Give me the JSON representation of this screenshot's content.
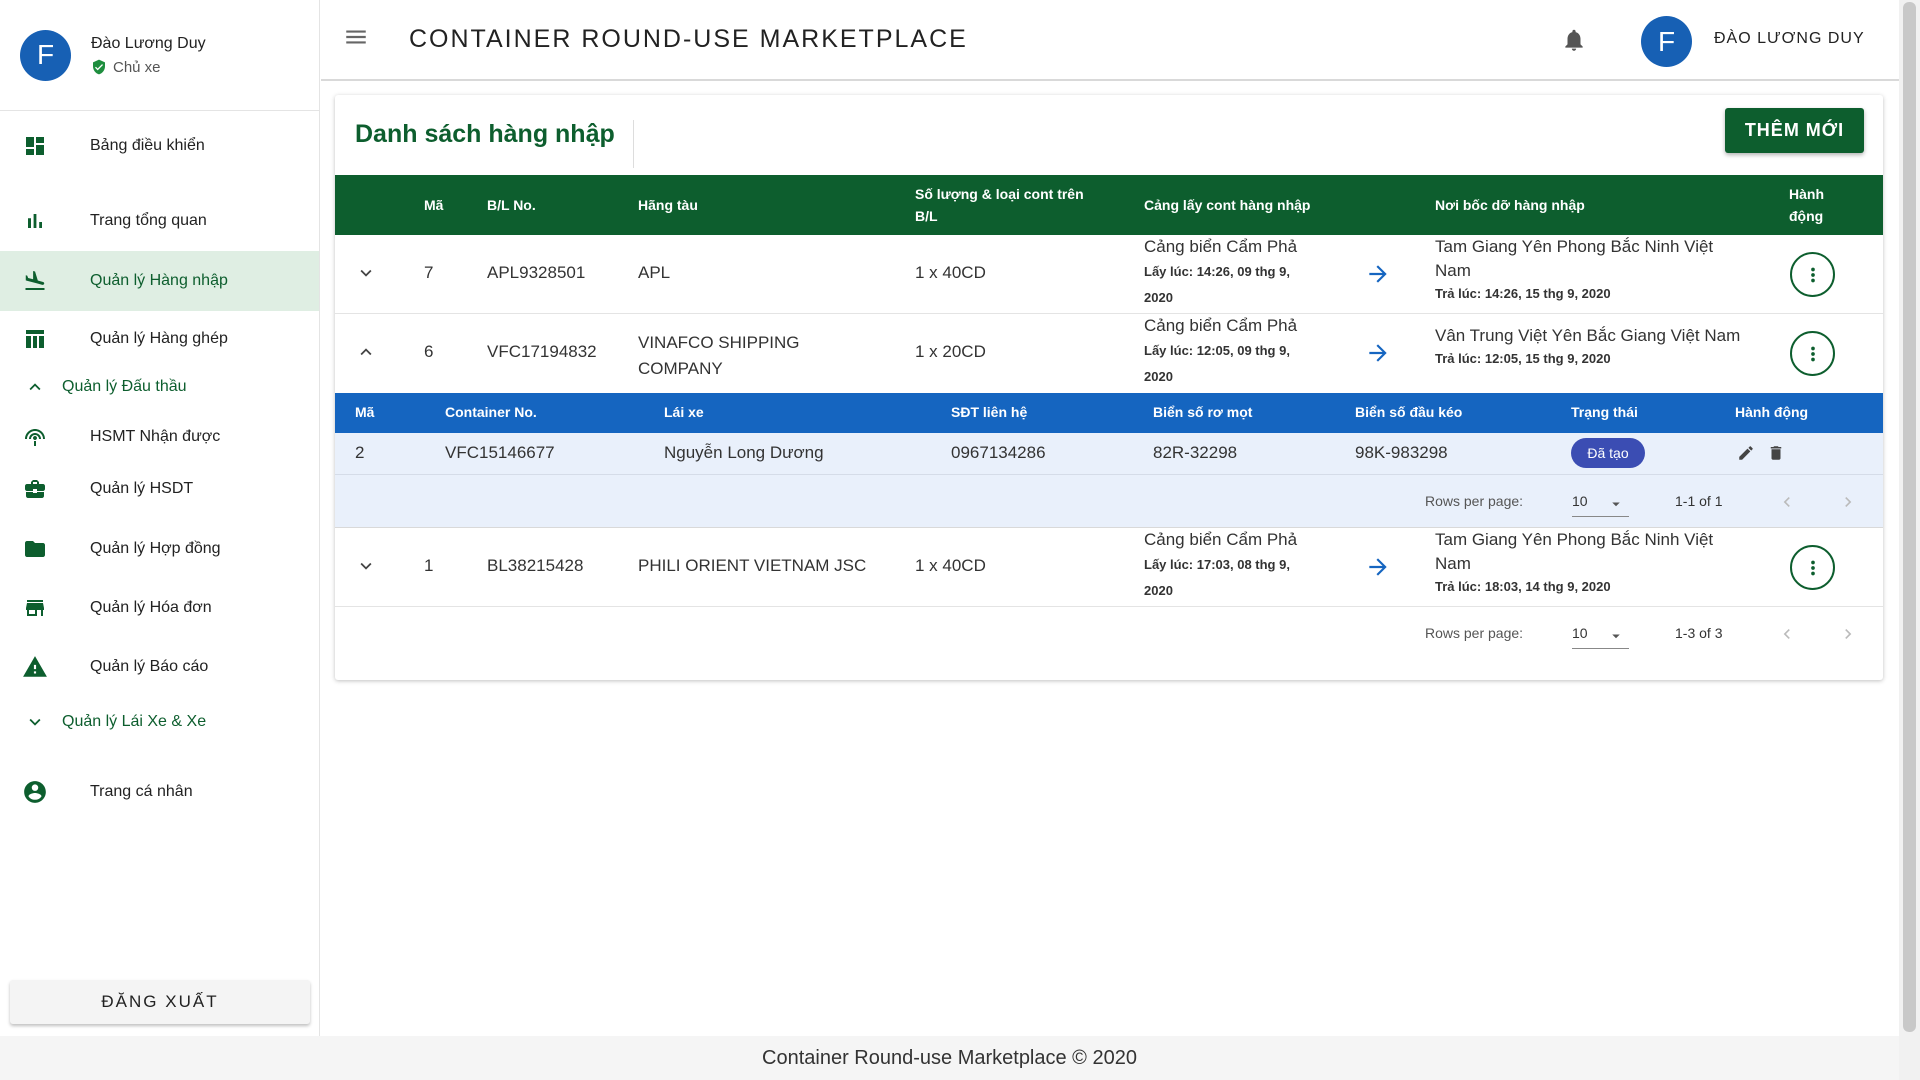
{
  "sidebar": {
    "user": {
      "avatar_letter": "F",
      "name": "Đào Lương Duy",
      "role": "Chủ xe"
    },
    "items": [
      {
        "label": "Bảng điều khiển",
        "icon": "dashboard-icon"
      },
      {
        "label": "Trang tổng quan",
        "icon": "bar-chart-icon"
      },
      {
        "label": "Quản lý Hàng nhập",
        "icon": "flight-land-icon"
      },
      {
        "label": "Quản lý Hàng ghép",
        "icon": "table-icon"
      },
      {
        "label": "Quản lý Đấu thầu",
        "icon": "chevron-up-icon"
      },
      {
        "label": "HSMT Nhận được",
        "icon": "wifi-tethering-icon"
      },
      {
        "label": "Quản lý HSDT",
        "icon": "briefcase-icon"
      },
      {
        "label": "Quản lý Hợp đồng",
        "icon": "folder-icon"
      },
      {
        "label": "Quản lý Hóa đơn",
        "icon": "store-icon"
      },
      {
        "label": "Quản lý Báo cáo",
        "icon": "warning-icon"
      },
      {
        "label": "Quản lý Lái Xe & Xe",
        "icon": "chevron-down-icon"
      },
      {
        "label": "Trang cá nhân",
        "icon": "account-circle-icon"
      }
    ],
    "logout_label": "ĐĂNG XUẤT"
  },
  "topbar": {
    "title": "CONTAINER ROUND-USE MARKETPLACE",
    "avatar_letter": "F",
    "username": "ĐÀO LƯƠNG DUY"
  },
  "main": {
    "title": "Danh sách hàng nhập",
    "add_button": "THÊM MỚI",
    "columns": {
      "id": "Mã",
      "bl": "B/L No.",
      "carrier": "Hãng tàu",
      "qty_line1": "Số lượng & loại cont trên",
      "qty_line2": "B/L",
      "port": "Cảng lấy cont hàng nhập",
      "dest": "Nơi bốc dỡ hàng nhập",
      "action_line1": "Hành",
      "action_line2": "động"
    },
    "rows": [
      {
        "id": "7",
        "bl": "APL9328501",
        "carrier_line1": "APL",
        "carrier_line2": "",
        "qty": "1 x 40CD",
        "port": "Cảng biển Cẩm Phả",
        "pickup_line1": "Lấy lúc: 14:26, 09 thg 9,",
        "pickup_line2": "2020",
        "dest_line1": "Tam Giang Yên Phong Bắc Ninh Việt",
        "dest_line2": "Nam",
        "return": "Trả lúc: 14:26, 15 thg 9, 2020"
      },
      {
        "id": "6",
        "bl": "VFC17194832",
        "carrier_line1": "VINAFCO SHIPPING",
        "carrier_line2": "COMPANY",
        "qty": "1 x 20CD",
        "port": "Cảng biển Cẩm Phả",
        "pickup_line1": "Lấy lúc: 12:05, 09 thg 9,",
        "pickup_line2": "2020",
        "dest_line1": "Vân Trung Việt Yên Bắc Giang Việt Nam",
        "dest_line2": "",
        "return": "Trả lúc: 12:05, 15 thg 9, 2020"
      },
      {
        "id": "1",
        "bl": "BL38215428",
        "carrier_line1": "PHILI ORIENT VIETNAM JSC",
        "carrier_line2": "",
        "qty": "1 x 40CD",
        "port": "Cảng biển Cẩm Phả",
        "pickup_line1": "Lấy lúc: 17:03, 08 thg 9,",
        "pickup_line2": "2020",
        "dest_line1": "Tam Giang Yên Phong Bắc Ninh Việt",
        "dest_line2": "Nam",
        "return": "Trả lúc: 18:03, 14 thg 9, 2020"
      }
    ],
    "sub_table": {
      "columns": [
        "Mã",
        "Container No.",
        "Lái xe",
        "SĐT liên hệ",
        "Biển số rơ mọt",
        "Biển số đầu kéo",
        "Trạng thái",
        "Hành động"
      ],
      "row": {
        "id": "2",
        "container": "VFC15146677",
        "driver": "Nguyễn Long Dương",
        "phone": "0967134286",
        "trailer": "82R-32298",
        "tractor": "98K-983298",
        "status": "Đã tạo"
      },
      "pager": {
        "label": "Rows per page:",
        "per_page": "10",
        "range": "1-1 of 1"
      }
    },
    "pager": {
      "label": "Rows per page:",
      "per_page": "10",
      "range": "1-3 of 3"
    }
  },
  "footer": {
    "text": "Container Round-use Marketplace © 2020"
  },
  "colors": {
    "primary": "#0d5e2e",
    "accent_blue": "#1565c0",
    "badge": "#3b4db3"
  }
}
